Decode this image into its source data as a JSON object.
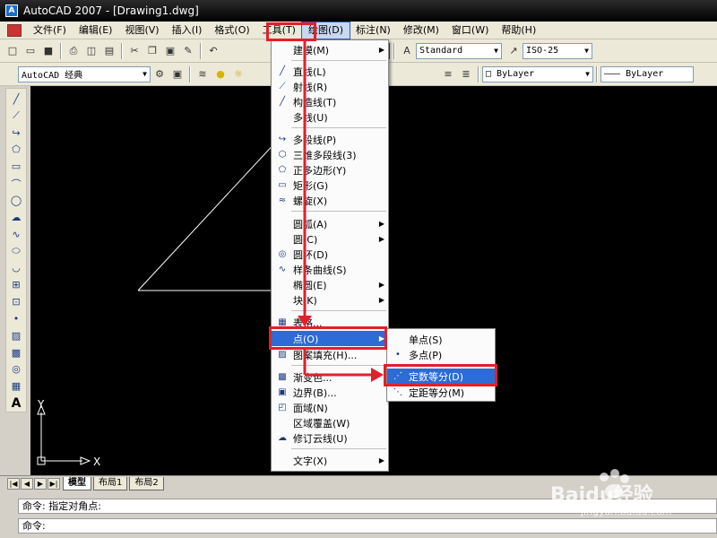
{
  "window": {
    "title": "AutoCAD 2007 - [Drawing1.dwg]",
    "app_icon_letter": "A"
  },
  "menubar": {
    "items": [
      {
        "label": "文件(F)"
      },
      {
        "label": "编辑(E)"
      },
      {
        "label": "视图(V)"
      },
      {
        "label": "插入(I)"
      },
      {
        "label": "格式(O)"
      },
      {
        "label": "工具(T)"
      },
      {
        "label": "绘图(D)"
      },
      {
        "label": "标注(N)"
      },
      {
        "label": "修改(M)"
      },
      {
        "label": "窗口(W)"
      },
      {
        "label": "帮助(H)"
      }
    ],
    "active_index": 6
  },
  "toolbar1": {
    "text_style": "Standard",
    "dim_style": "ISO-25"
  },
  "toolbar2": {
    "workspace": "AutoCAD 经典",
    "color": "ByLayer",
    "linetype": "ByLayer"
  },
  "draw_menu": {
    "items": [
      {
        "label": "建模(M)",
        "icon": "",
        "submenu": true
      },
      {
        "label": "直线(L)",
        "icon": "line-icon"
      },
      {
        "label": "射线(R)",
        "icon": "ray-icon"
      },
      {
        "label": "构造线(T)",
        "icon": "construction-line-icon"
      },
      {
        "label": "多线(U)",
        "icon": ""
      },
      {
        "label": "多段线(P)",
        "icon": "polyline-icon"
      },
      {
        "label": "三维多段线(3)",
        "icon": "3d-polyline-icon"
      },
      {
        "label": "正多边形(Y)",
        "icon": "polygon-icon"
      },
      {
        "label": "矩形(G)",
        "icon": "rectangle-icon"
      },
      {
        "label": "螺旋(X)",
        "icon": "helix-icon"
      },
      {
        "label": "圆弧(A)",
        "icon": "",
        "submenu": true
      },
      {
        "label": "圆(C)",
        "icon": "",
        "submenu": true
      },
      {
        "label": "圆环(D)",
        "icon": "donut-icon"
      },
      {
        "label": "样条曲线(S)",
        "icon": "spline-icon"
      },
      {
        "label": "椭圆(E)",
        "icon": "",
        "submenu": true
      },
      {
        "label": "块(K)",
        "icon": "",
        "submenu": true
      },
      {
        "label": "表格...",
        "icon": "table-icon"
      },
      {
        "label": "点(O)",
        "icon": "",
        "submenu": true
      },
      {
        "label": "图案填充(H)...",
        "icon": "hatch-icon"
      },
      {
        "label": "渐变色...",
        "icon": "gradient-icon"
      },
      {
        "label": "边界(B)...",
        "icon": "boundary-icon"
      },
      {
        "label": "面域(N)",
        "icon": "region-icon"
      },
      {
        "label": "区域覆盖(W)",
        "icon": ""
      },
      {
        "label": "修订云线(U)",
        "icon": "revcloud-icon"
      },
      {
        "label": "文字(X)",
        "icon": "",
        "submenu": true
      }
    ],
    "highlighted": "点(O)"
  },
  "point_submenu": {
    "items": [
      {
        "label": "单点(S)",
        "icon": ""
      },
      {
        "label": "多点(P)",
        "icon": "multiple-point-icon"
      },
      {
        "label": "定数等分(D)",
        "icon": "divide-icon"
      },
      {
        "label": "定距等分(M)",
        "icon": "measure-icon"
      }
    ],
    "highlighted": "定数等分(D)"
  },
  "ucs": {
    "x_label": "X",
    "y_label": "Y"
  },
  "layout_tabs": [
    {
      "label": "模型",
      "active": true
    },
    {
      "label": "布局1",
      "active": false
    },
    {
      "label": "布局2",
      "active": false
    }
  ],
  "command_line": {
    "line1": "命令: 指定对角点:",
    "line2": "命令:"
  },
  "watermark": {
    "text": "Baidu经验",
    "url": "jingyan.baidu.com"
  },
  "colors": {
    "annotation_red": "#e2202a",
    "menu_highlight": "#2d6bd6",
    "canvas": "#000000"
  }
}
